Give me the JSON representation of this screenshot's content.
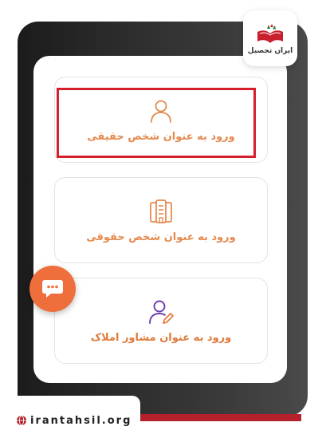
{
  "brand": {
    "logo_text": "ایران تحصیل",
    "site_url": "irantahsil.org"
  },
  "options": [
    {
      "label": "ورود به عنوان شخص حقیقی",
      "icon": "person-icon"
    },
    {
      "label": "ورود به عنوان شخص حقوقی",
      "icon": "building-icon"
    },
    {
      "label": "ورود به عنوان مشاور املاک",
      "icon": "user-edit-icon"
    }
  ],
  "colors": {
    "accent": "#e58a50",
    "highlight": "#d4202c",
    "chat_button": "#ef6f3c",
    "advisor_icon": "#6a3fb0"
  }
}
